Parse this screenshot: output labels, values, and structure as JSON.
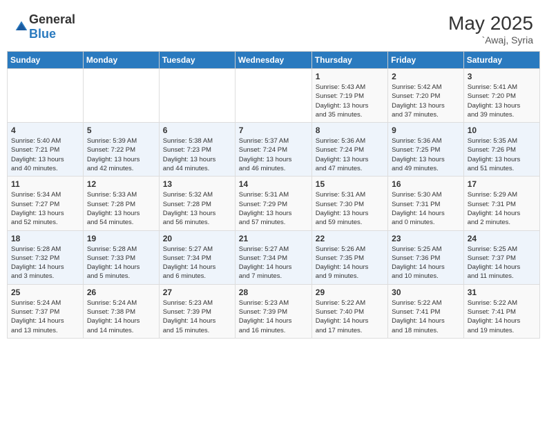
{
  "header": {
    "logo_general": "General",
    "logo_blue": "Blue",
    "month_year": "May 2025",
    "location": "`Awaj, Syria"
  },
  "weekdays": [
    "Sunday",
    "Monday",
    "Tuesday",
    "Wednesday",
    "Thursday",
    "Friday",
    "Saturday"
  ],
  "weeks": [
    [
      {
        "day": "",
        "info": ""
      },
      {
        "day": "",
        "info": ""
      },
      {
        "day": "",
        "info": ""
      },
      {
        "day": "",
        "info": ""
      },
      {
        "day": "1",
        "info": "Sunrise: 5:43 AM\nSunset: 7:19 PM\nDaylight: 13 hours\nand 35 minutes."
      },
      {
        "day": "2",
        "info": "Sunrise: 5:42 AM\nSunset: 7:20 PM\nDaylight: 13 hours\nand 37 minutes."
      },
      {
        "day": "3",
        "info": "Sunrise: 5:41 AM\nSunset: 7:20 PM\nDaylight: 13 hours\nand 39 minutes."
      }
    ],
    [
      {
        "day": "4",
        "info": "Sunrise: 5:40 AM\nSunset: 7:21 PM\nDaylight: 13 hours\nand 40 minutes."
      },
      {
        "day": "5",
        "info": "Sunrise: 5:39 AM\nSunset: 7:22 PM\nDaylight: 13 hours\nand 42 minutes."
      },
      {
        "day": "6",
        "info": "Sunrise: 5:38 AM\nSunset: 7:23 PM\nDaylight: 13 hours\nand 44 minutes."
      },
      {
        "day": "7",
        "info": "Sunrise: 5:37 AM\nSunset: 7:24 PM\nDaylight: 13 hours\nand 46 minutes."
      },
      {
        "day": "8",
        "info": "Sunrise: 5:36 AM\nSunset: 7:24 PM\nDaylight: 13 hours\nand 47 minutes."
      },
      {
        "day": "9",
        "info": "Sunrise: 5:36 AM\nSunset: 7:25 PM\nDaylight: 13 hours\nand 49 minutes."
      },
      {
        "day": "10",
        "info": "Sunrise: 5:35 AM\nSunset: 7:26 PM\nDaylight: 13 hours\nand 51 minutes."
      }
    ],
    [
      {
        "day": "11",
        "info": "Sunrise: 5:34 AM\nSunset: 7:27 PM\nDaylight: 13 hours\nand 52 minutes."
      },
      {
        "day": "12",
        "info": "Sunrise: 5:33 AM\nSunset: 7:28 PM\nDaylight: 13 hours\nand 54 minutes."
      },
      {
        "day": "13",
        "info": "Sunrise: 5:32 AM\nSunset: 7:28 PM\nDaylight: 13 hours\nand 56 minutes."
      },
      {
        "day": "14",
        "info": "Sunrise: 5:31 AM\nSunset: 7:29 PM\nDaylight: 13 hours\nand 57 minutes."
      },
      {
        "day": "15",
        "info": "Sunrise: 5:31 AM\nSunset: 7:30 PM\nDaylight: 13 hours\nand 59 minutes."
      },
      {
        "day": "16",
        "info": "Sunrise: 5:30 AM\nSunset: 7:31 PM\nDaylight: 14 hours\nand 0 minutes."
      },
      {
        "day": "17",
        "info": "Sunrise: 5:29 AM\nSunset: 7:31 PM\nDaylight: 14 hours\nand 2 minutes."
      }
    ],
    [
      {
        "day": "18",
        "info": "Sunrise: 5:28 AM\nSunset: 7:32 PM\nDaylight: 14 hours\nand 3 minutes."
      },
      {
        "day": "19",
        "info": "Sunrise: 5:28 AM\nSunset: 7:33 PM\nDaylight: 14 hours\nand 5 minutes."
      },
      {
        "day": "20",
        "info": "Sunrise: 5:27 AM\nSunset: 7:34 PM\nDaylight: 14 hours\nand 6 minutes."
      },
      {
        "day": "21",
        "info": "Sunrise: 5:27 AM\nSunset: 7:34 PM\nDaylight: 14 hours\nand 7 minutes."
      },
      {
        "day": "22",
        "info": "Sunrise: 5:26 AM\nSunset: 7:35 PM\nDaylight: 14 hours\nand 9 minutes."
      },
      {
        "day": "23",
        "info": "Sunrise: 5:25 AM\nSunset: 7:36 PM\nDaylight: 14 hours\nand 10 minutes."
      },
      {
        "day": "24",
        "info": "Sunrise: 5:25 AM\nSunset: 7:37 PM\nDaylight: 14 hours\nand 11 minutes."
      }
    ],
    [
      {
        "day": "25",
        "info": "Sunrise: 5:24 AM\nSunset: 7:37 PM\nDaylight: 14 hours\nand 13 minutes."
      },
      {
        "day": "26",
        "info": "Sunrise: 5:24 AM\nSunset: 7:38 PM\nDaylight: 14 hours\nand 14 minutes."
      },
      {
        "day": "27",
        "info": "Sunrise: 5:23 AM\nSunset: 7:39 PM\nDaylight: 14 hours\nand 15 minutes."
      },
      {
        "day": "28",
        "info": "Sunrise: 5:23 AM\nSunset: 7:39 PM\nDaylight: 14 hours\nand 16 minutes."
      },
      {
        "day": "29",
        "info": "Sunrise: 5:22 AM\nSunset: 7:40 PM\nDaylight: 14 hours\nand 17 minutes."
      },
      {
        "day": "30",
        "info": "Sunrise: 5:22 AM\nSunset: 7:41 PM\nDaylight: 14 hours\nand 18 minutes."
      },
      {
        "day": "31",
        "info": "Sunrise: 5:22 AM\nSunset: 7:41 PM\nDaylight: 14 hours\nand 19 minutes."
      }
    ]
  ]
}
